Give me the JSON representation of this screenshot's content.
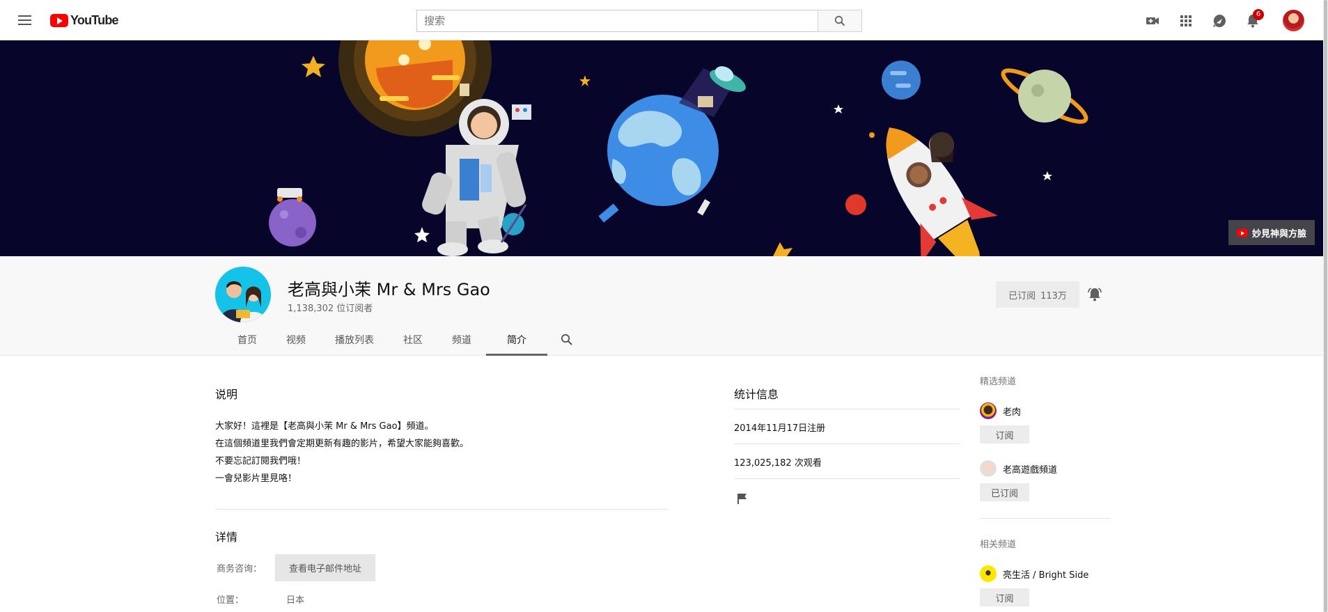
{
  "header": {
    "logo_text": "YouTube",
    "search_placeholder": "搜索",
    "notification_count": "6",
    "icons": [
      "menu-icon",
      "search-icon",
      "create-video-icon",
      "apps-grid-icon",
      "messages-icon",
      "bell-icon"
    ]
  },
  "banner": {
    "link_label": "妙見神與方臉"
  },
  "channel": {
    "title": "老高與小茉 Mr & Mrs Gao",
    "subscribers": "1,138,302 位订阅者",
    "subscribed_label": "已订阅",
    "subscribed_count": "113万"
  },
  "tabs": [
    {
      "label": "首页"
    },
    {
      "label": "视频"
    },
    {
      "label": "播放列表"
    },
    {
      "label": "社区"
    },
    {
      "label": "频道"
    },
    {
      "label": "简介",
      "active": true
    }
  ],
  "about": {
    "description_title": "说明",
    "description_lines": [
      "大家好！這裡是【老高與小茉 Mr & Mrs Gao】頻道。",
      "在這個頻道里我們會定期更新有趣的影片，希望大家能夠喜歡。",
      "不要忘記訂閱我們哦！",
      "一會兒影片里見咯！"
    ],
    "details_title": "详情",
    "business_label": "商务咨询：",
    "email_button": "查看电子邮件地址",
    "location_label": "位置：",
    "location_value": "日本"
  },
  "stats": {
    "title": "统计信息",
    "joined": "2014年11月17日注册",
    "views": "123,025,182 次观看"
  },
  "sidebar": {
    "featured_title": "精选频道",
    "featured": [
      {
        "name": "老肉",
        "button": "订阅"
      },
      {
        "name": "老高遊戲頻道",
        "button": "已订阅"
      }
    ],
    "related_title": "相关频道",
    "related": [
      {
        "name": "亮生活 / Bright Side",
        "button": "订阅"
      }
    ]
  },
  "colors": {
    "brand_red": "#ff0000",
    "banner_bg": "#07062a",
    "header_bg": "#f8f8f8"
  }
}
